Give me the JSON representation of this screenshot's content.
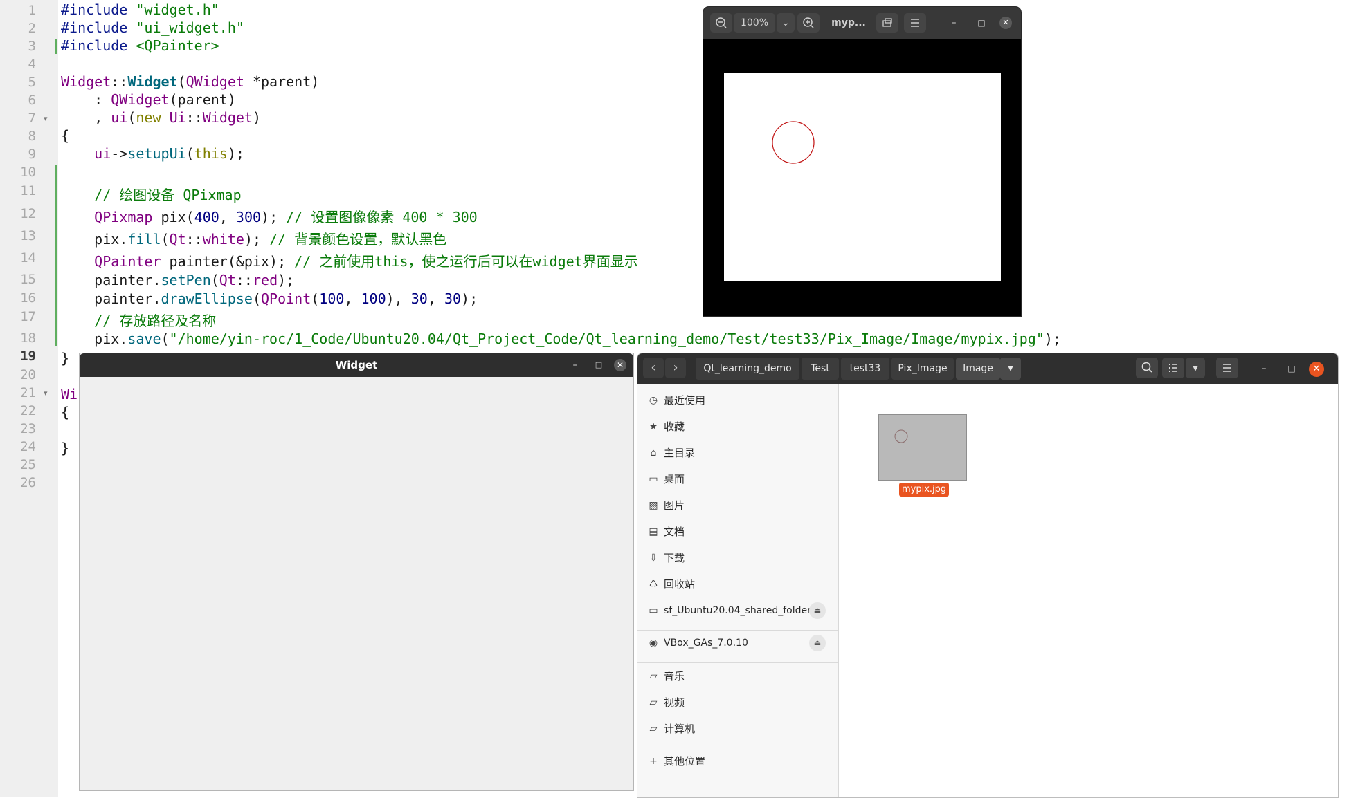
{
  "editor": {
    "line_numbers": [
      "1",
      "2",
      "3",
      "4",
      "5",
      "6",
      "7",
      "8",
      "9",
      "10",
      "11",
      "12",
      "13",
      "14",
      "15",
      "16",
      "17",
      "18",
      "19",
      "20",
      "21",
      "22",
      "23",
      "24",
      "25",
      "26"
    ],
    "current_line": "19",
    "lines": {
      "l1_a": "#include",
      "l1_b": "\"widget.h\"",
      "l2_a": "#include",
      "l2_b": "\"ui_widget.h\"",
      "l3_a": "#include",
      "l3_b": "<QPainter>",
      "l5_a": "Widget",
      "l5_b": "::",
      "l5_c": "Widget",
      "l5_d": "(",
      "l5_e": "QWidget",
      "l5_f": " *parent)",
      "l6_a": "    : ",
      "l6_b": "QWidget",
      "l6_c": "(parent)",
      "l7_a": "    , ",
      "l7_b": "ui",
      "l7_c": "(",
      "l7_d": "new",
      "l7_e": " ",
      "l7_f": "Ui",
      "l7_g": "::",
      "l7_h": "Widget",
      "l7_i": ")",
      "l8": "{",
      "l9_a": "    ",
      "l9_b": "ui",
      "l9_c": "->",
      "l9_d": "setupUi",
      "l9_e": "(",
      "l9_f": "this",
      "l9_g": ");",
      "l11": "    // 绘图设备 QPixmap",
      "l12_a": "    ",
      "l12_b": "QPixmap",
      "l12_c": " pix(",
      "l12_d": "400",
      "l12_e": ", ",
      "l12_f": "300",
      "l12_g": "); ",
      "l12_h": "// 设置图像像素 400 * 300",
      "l13_a": "    pix.",
      "l13_b": "fill",
      "l13_c": "(",
      "l13_d": "Qt",
      "l13_e": "::",
      "l13_f": "white",
      "l13_g": "); ",
      "l13_h": "// 背景颜色设置，默认黑色",
      "l14_a": "    ",
      "l14_b": "QPainter",
      "l14_c": " painter(&pix); ",
      "l14_d": "// 之前使用this，使之运行后可以在widget界面显示",
      "l15_a": "    painter.",
      "l15_b": "setPen",
      "l15_c": "(",
      "l15_d": "Qt",
      "l15_e": "::",
      "l15_f": "red",
      "l15_g": ");",
      "l16_a": "    painter.",
      "l16_b": "drawEllipse",
      "l16_c": "(",
      "l16_d": "QPoint",
      "l16_e": "(",
      "l16_f": "100",
      "l16_g": ", ",
      "l16_h": "100",
      "l16_i": "), ",
      "l16_j": "30",
      "l16_k": ", ",
      "l16_l": "30",
      "l16_m": ");",
      "l17": "    // 存放路径及名称",
      "l18_a": "    pix.",
      "l18_b": "save",
      "l18_c": "(",
      "l18_d": "\"/home/yin-roc/1_Code/Ubuntu20.04/Qt_Project_Code/Qt_learning_demo/Test/test33/Pix_Image/Image/mypix.jpg\"",
      "l18_e": ");",
      "l19": "}",
      "l21": "Wi",
      "l22": "{",
      "l24": "}"
    }
  },
  "image_viewer": {
    "zoom_out_icon": "zoom-out-icon",
    "zoom": "100%",
    "zoom_menu_icon": "chevron-down-icon",
    "zoom_in_icon": "zoom-in-icon",
    "title": "myp...",
    "rotate_icon": "rotate-icon",
    "menu_icon": "hamburger-icon",
    "minimize": "–",
    "maximize": "□",
    "close": "✕",
    "circle_color": "#c01010"
  },
  "widget_window": {
    "title": "Widget",
    "minimize": "–",
    "maximize": "□",
    "close": "✕"
  },
  "file_manager": {
    "back": "‹",
    "forward": "›",
    "breadcrumbs": [
      "Qt_learning_demo",
      "Test",
      "test33",
      "Pix_Image",
      "Image"
    ],
    "breadcrumb_menu": "▾",
    "search_icon": "search-icon",
    "view_icon": "list-view-icon",
    "view_menu": "▾",
    "menu_icon": "hamburger-icon",
    "minimize": "–",
    "maximize": "□",
    "close": "✕",
    "sidebar": [
      {
        "icon": "clock-icon",
        "glyph": "◷",
        "label": "最近使用"
      },
      {
        "icon": "star-icon",
        "glyph": "★",
        "label": "收藏"
      },
      {
        "icon": "home-icon",
        "glyph": "⌂",
        "label": "主目录"
      },
      {
        "icon": "desktop-icon",
        "glyph": "▭",
        "label": "桌面"
      },
      {
        "icon": "picture-icon",
        "glyph": "▨",
        "label": "图片"
      },
      {
        "icon": "document-icon",
        "glyph": "▤",
        "label": "文档"
      },
      {
        "icon": "download-icon",
        "glyph": "⇩",
        "label": "下载"
      },
      {
        "icon": "trash-icon",
        "glyph": "♺",
        "label": "回收站"
      },
      {
        "icon": "drive-icon",
        "glyph": "▭",
        "label": "sf_Ubuntu20.04_shared_folder"
      },
      {
        "icon": "disc-icon",
        "glyph": "◉",
        "label": "VBox_GAs_7.0.10"
      },
      {
        "icon": "folder-icon",
        "glyph": "▱",
        "label": "音乐"
      },
      {
        "icon": "folder-icon",
        "glyph": "▱",
        "label": "视频"
      },
      {
        "icon": "folder-icon",
        "glyph": "▱",
        "label": "计算机"
      },
      {
        "icon": "plus-icon",
        "glyph": "+",
        "label": "其他位置"
      }
    ],
    "eject_glyph": "⏏",
    "file_name": "mypix.jpg"
  }
}
